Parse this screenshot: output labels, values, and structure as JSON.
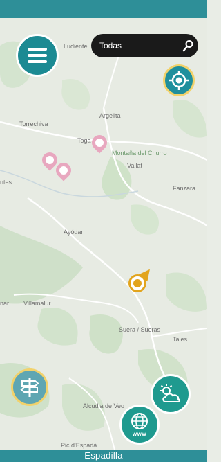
{
  "search": {
    "value": "Todas",
    "icon": "search-icon"
  },
  "map": {
    "places": [
      {
        "label": "Ludiente"
      },
      {
        "label": "Argelita"
      },
      {
        "label": "Torrechiva"
      },
      {
        "label": "Toga"
      },
      {
        "label": "Montaña del Churro"
      },
      {
        "label": "Vallat"
      },
      {
        "label": "Fanzara"
      },
      {
        "label": "ntes"
      },
      {
        "label": "Ayódar"
      },
      {
        "label": "Villamalur"
      },
      {
        "label": "nar"
      },
      {
        "label": "Suera / Sueras"
      },
      {
        "label": "Tales"
      },
      {
        "label": "Alcudia de Veo"
      },
      {
        "label": "Pic d'Espadà"
      }
    ],
    "pins_color": "#e8a7bf",
    "user_marker_color": "#e2a41d"
  },
  "buttons": {
    "menu_icon": "menu-icon",
    "locate_icon": "target-icon",
    "routes_icon": "signpost-icon",
    "weather_icon": "weather-icon",
    "web_icon": "globe-icon",
    "web_label": "www"
  },
  "footer": {
    "location": "Espadilla"
  },
  "colors": {
    "bar": "#2e8f98",
    "button_teal": "#1c8a93",
    "accent_yellow": "#f2d26b"
  }
}
